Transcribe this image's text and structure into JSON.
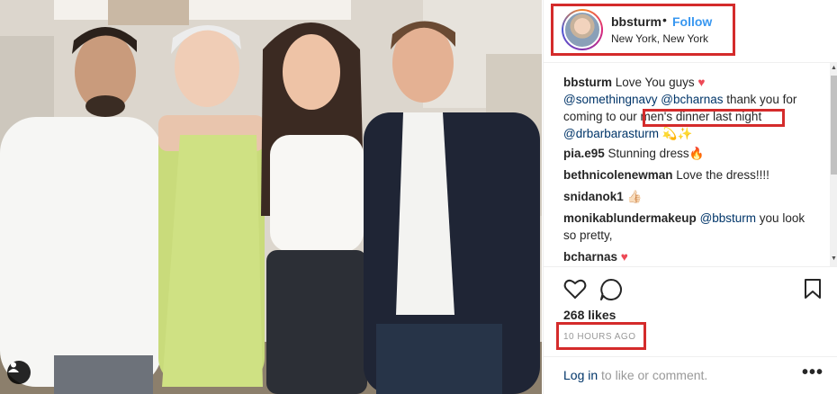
{
  "post": {
    "username": "bbsturm",
    "separator": "•",
    "follow_label": "Follow",
    "location": "New York, New York"
  },
  "comments": [
    {
      "user": "bbsturm",
      "parts": [
        {
          "t": " Love You guys "
        },
        {
          "t": "♥",
          "c": "heart"
        }
      ]
    },
    {
      "user": "",
      "parts": [
        {
          "t": "@somethingnavy",
          "c": "mention"
        },
        {
          "t": " "
        },
        {
          "t": "@bcharnas",
          "c": "mention"
        },
        {
          "t": " thank you for coming to our men's dinner last night "
        },
        {
          "t": "@drbarbarasturm",
          "c": "mention"
        },
        {
          "t": " 💫✨"
        }
      ]
    },
    {
      "user": "pia.e95",
      "parts": [
        {
          "t": " Stunning dress🔥"
        }
      ]
    },
    {
      "user": "bethnicolenewman",
      "parts": [
        {
          "t": " Love the dress!!!!"
        }
      ]
    },
    {
      "user": "snidanok1",
      "parts": [
        {
          "t": " 👍🏻"
        }
      ]
    },
    {
      "user": "monikablundermakeup",
      "parts": [
        {
          "t": " "
        },
        {
          "t": "@bbsturm",
          "c": "mention"
        },
        {
          "t": " you look so pretty,"
        }
      ]
    },
    {
      "user": "bcharnas",
      "parts": [
        {
          "t": " "
        },
        {
          "t": "♥",
          "c": "heart"
        }
      ]
    }
  ],
  "actions": {
    "like_icon": "heart-outline-icon",
    "comment_icon": "speech-bubble-icon",
    "save_icon": "bookmark-icon"
  },
  "likes": "268 likes",
  "timestamp": "10 HOURS AGO",
  "footer": {
    "login_link": "Log in",
    "login_rest": " to like or comment.",
    "more": "•••"
  },
  "photo": {
    "tag_icon": "person-tag-icon"
  },
  "colors": {
    "accent": "#3897f0",
    "mention": "#003569",
    "highlight": "#d42b2b",
    "heart": "#ed4956"
  }
}
